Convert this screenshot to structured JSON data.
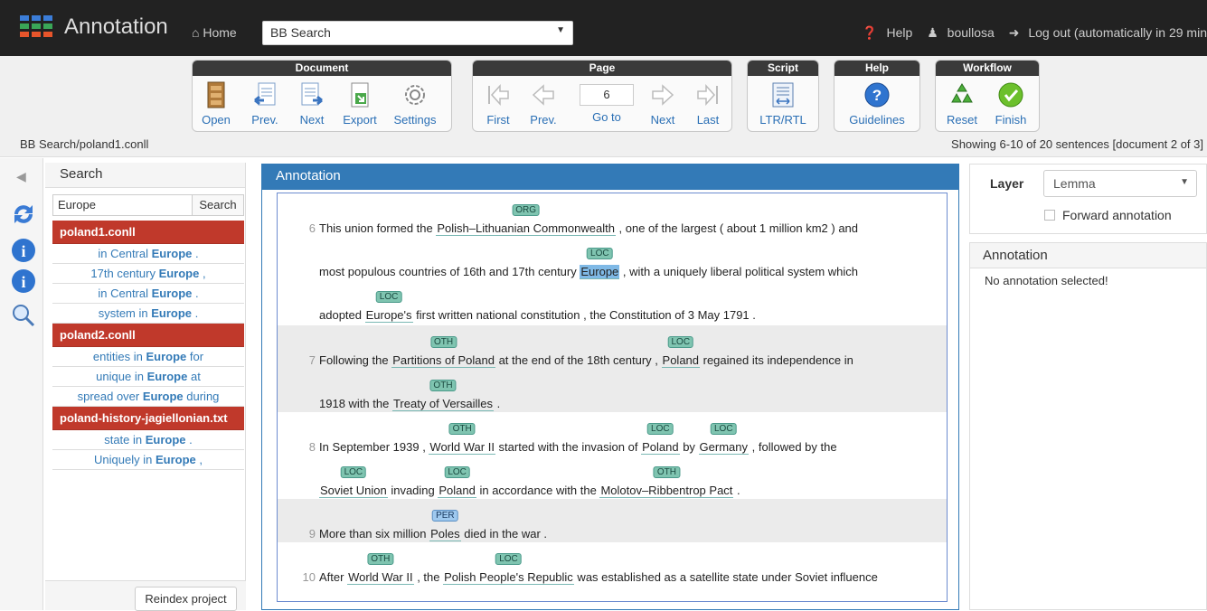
{
  "nav": {
    "brand": "Annotation",
    "home": "Home",
    "project": "BB Search",
    "help": "Help",
    "user": "boullosa",
    "logout": "Log out (automatically in 29 min"
  },
  "toolbar": {
    "document": {
      "title": "Document",
      "open": "Open",
      "prev": "Prev.",
      "next": "Next",
      "export": "Export",
      "settings": "Settings"
    },
    "page": {
      "title": "Page",
      "first": "First",
      "prev": "Prev.",
      "goto": "Go to",
      "next": "Next",
      "last": "Last",
      "current": "6"
    },
    "script": {
      "title": "Script",
      "ltrrtl": "LTR/RTL"
    },
    "help": {
      "title": "Help",
      "guidelines": "Guidelines"
    },
    "workflow": {
      "title": "Workflow",
      "reset": "Reset",
      "finish": "Finish"
    }
  },
  "doc_path": "BB Search/poland1.conll",
  "showing": "Showing 6-10 of 20 sentences [document 2 of 3]",
  "search": {
    "title": "Search",
    "query": "Europe",
    "button": "Search",
    "reindex": "Reindex project",
    "files": [
      {
        "name": "poland1.conll",
        "results": [
          {
            "pre": "in Central ",
            "hit": "Europe",
            "post": " ."
          },
          {
            "pre": "17th century ",
            "hit": "Europe",
            "post": " ,"
          },
          {
            "pre": "in Central ",
            "hit": "Europe",
            "post": " ."
          },
          {
            "pre": "system in ",
            "hit": "Europe",
            "post": " ."
          }
        ]
      },
      {
        "name": "poland2.conll",
        "results": [
          {
            "pre": "entities in ",
            "hit": "Europe",
            "post": " for"
          },
          {
            "pre": "unique in ",
            "hit": "Europe",
            "post": " at"
          },
          {
            "pre": "spread over ",
            "hit": "Europe",
            "post": " during"
          }
        ]
      },
      {
        "name": "poland-history-jagiellonian.txt",
        "results": [
          {
            "pre": "state in ",
            "hit": "Europe",
            "post": " ."
          },
          {
            "pre": "Uniquely in ",
            "hit": "Europe",
            "post": " ,"
          }
        ]
      }
    ]
  },
  "annotation": {
    "title": "Annotation",
    "sentences": [
      {
        "num": "6",
        "lines": [
          [
            {
              "t": "This union formed the "
            },
            {
              "t": "Polish–Lithuanian Commonwealth",
              "l": "ORG"
            },
            {
              "t": " , one of the largest ( about 1 million km2 ) and"
            }
          ],
          [
            {
              "t": "most populous countries of 16th and 17th century "
            },
            {
              "t": "Europe",
              "l": "LOC",
              "sel": true
            },
            {
              "t": " , with a uniquely liberal political system which"
            }
          ],
          [
            {
              "t": "adopted "
            },
            {
              "t": "Europe's",
              "l": "LOC"
            },
            {
              "t": " first written national constitution , the Constitution of 3 May 1791 ."
            }
          ]
        ]
      },
      {
        "num": "7",
        "lines": [
          [
            {
              "t": "Following the "
            },
            {
              "t": "Partitions of Poland",
              "l": "OTH"
            },
            {
              "t": " at the end of the 18th century , "
            },
            {
              "t": "Poland",
              "l": "LOC"
            },
            {
              "t": " regained its independence in"
            }
          ],
          [
            {
              "t": "1918 with the "
            },
            {
              "t": "Treaty of Versailles",
              "l": "OTH"
            },
            {
              "t": " ."
            }
          ]
        ]
      },
      {
        "num": "8",
        "lines": [
          [
            {
              "t": "In September 1939 , "
            },
            {
              "t": "World War II",
              "l": "OTH"
            },
            {
              "t": " started with the invasion of "
            },
            {
              "t": "Poland",
              "l": "LOC"
            },
            {
              "t": " by "
            },
            {
              "t": "Germany",
              "l": "LOC"
            },
            {
              "t": " , followed by the"
            }
          ],
          [
            {
              "t": "Soviet Union",
              "l": "LOC"
            },
            {
              "t": " invading "
            },
            {
              "t": "Poland",
              "l": "LOC"
            },
            {
              "t": " in accordance with the "
            },
            {
              "t": "Molotov–Ribbentrop Pact",
              "l": "OTH"
            },
            {
              "t": " ."
            }
          ]
        ]
      },
      {
        "num": "9",
        "lines": [
          [
            {
              "t": "More than six million "
            },
            {
              "t": "Poles",
              "l": "PER"
            },
            {
              "t": " died in the war ."
            }
          ]
        ]
      },
      {
        "num": "10",
        "lines": [
          [
            {
              "t": "After "
            },
            {
              "t": "World War II",
              "l": "OTH"
            },
            {
              "t": " , the "
            },
            {
              "t": "Polish People's Republic",
              "l": "LOC"
            },
            {
              "t": " was established as a satellite state under Soviet influence"
            }
          ],
          [
            {
              "t": "."
            }
          ]
        ]
      }
    ]
  },
  "right": {
    "layer_label": "Layer",
    "layer_value": "Lemma",
    "forward": "Forward annotation",
    "annotation_title": "Annotation",
    "annotation_msg": "No annotation selected!"
  },
  "colors": {
    "navbar": "#222222",
    "accent": "#337ab7",
    "file_header": "#c0392b",
    "entity_label": "#7fc4b0"
  }
}
